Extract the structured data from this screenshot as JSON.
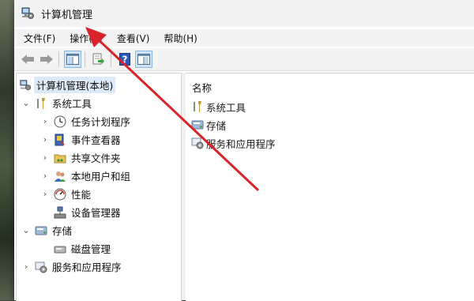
{
  "window": {
    "title": "计算机管理"
  },
  "menu": [
    "文件(F)",
    "操作(A)",
    "查看(V)",
    "帮助(H)"
  ],
  "toolbar": {
    "buttons": [
      "back-arrow-icon",
      "forward-arrow-icon",
      "show-hide-tree-icon",
      "export-list-icon",
      "help-icon",
      "show-hide-action-pane-icon"
    ]
  },
  "tree": {
    "root": "计算机管理(本地)",
    "system_tools": "系统工具",
    "task_scheduler": "任务计划程序",
    "event_viewer": "事件查看器",
    "shared_folders": "共享文件夹",
    "local_users": "本地用户和组",
    "performance": "性能",
    "device_manager": "设备管理器",
    "storage": "存储",
    "disk_management": "磁盘管理",
    "services_apps": "服务和应用程序"
  },
  "list": {
    "header": "名称",
    "items": [
      "系统工具",
      "存储",
      "服务和应用程序"
    ]
  },
  "colors": {
    "accent_arrow": "#d8232a",
    "selection": "#dbe9f8"
  }
}
